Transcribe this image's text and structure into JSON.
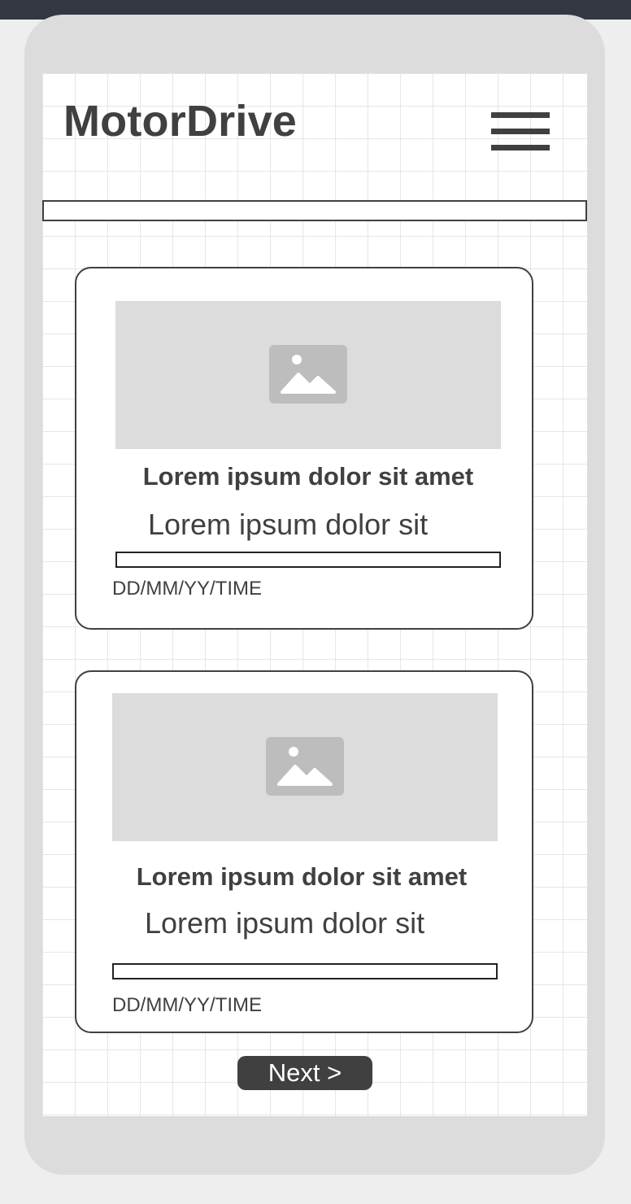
{
  "app": {
    "brand": "MotorDrive"
  },
  "header": {
    "menu_icon": "hamburger-menu-icon"
  },
  "cards": [
    {
      "image_icon": "image-placeholder-icon",
      "title": "Lorem ipsum dolor sit amet",
      "subtitle": "Lorem ipsum dolor sit",
      "date": "DD/MM/YY/TIME"
    },
    {
      "image_icon": "image-placeholder-icon",
      "title": "Lorem ipsum dolor sit amet",
      "subtitle": "Lorem ipsum dolor sit",
      "date": "DD/MM/YY/TIME"
    }
  ],
  "pagination": {
    "next_label": "Next >"
  },
  "colors": {
    "text": "#404040",
    "placeholder": "#dcdcdc",
    "button": "#404040",
    "topbar": "#333742"
  }
}
